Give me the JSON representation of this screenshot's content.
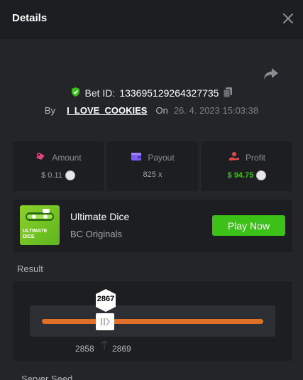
{
  "header": {
    "title": "Details"
  },
  "bet": {
    "id_label": "Bet ID:",
    "id": "133695129264327735",
    "by_label": "By",
    "user": "I_LOVE_COOKIES",
    "on_label": "On",
    "date": "26. 4. 2023 15:03:38"
  },
  "stats": [
    {
      "label": "Amount",
      "value": "$ 0.11",
      "icon": "money-icon",
      "color": "#e0457b"
    },
    {
      "label": "Payout",
      "value": "825 x",
      "icon": "wallet-icon",
      "color": "#7b5cf5"
    },
    {
      "label": "Profit",
      "value": "$ 94.75",
      "icon": "hand-coin-icon",
      "color": "#e04a4a"
    }
  ],
  "game": {
    "name": "Ultimate Dice",
    "provider": "BC Originals",
    "play_label": "Play Now",
    "thumb_text": "ULTIMATE\nDICE"
  },
  "result": {
    "label": "Result",
    "value": "2867",
    "range_low": "2858",
    "range_high": "2869"
  },
  "next_section": {
    "label": "Server Seed"
  },
  "colors": {
    "accent_green": "#3bc117",
    "slider_orange": "#e06f27",
    "panel": "#1c1e21"
  }
}
